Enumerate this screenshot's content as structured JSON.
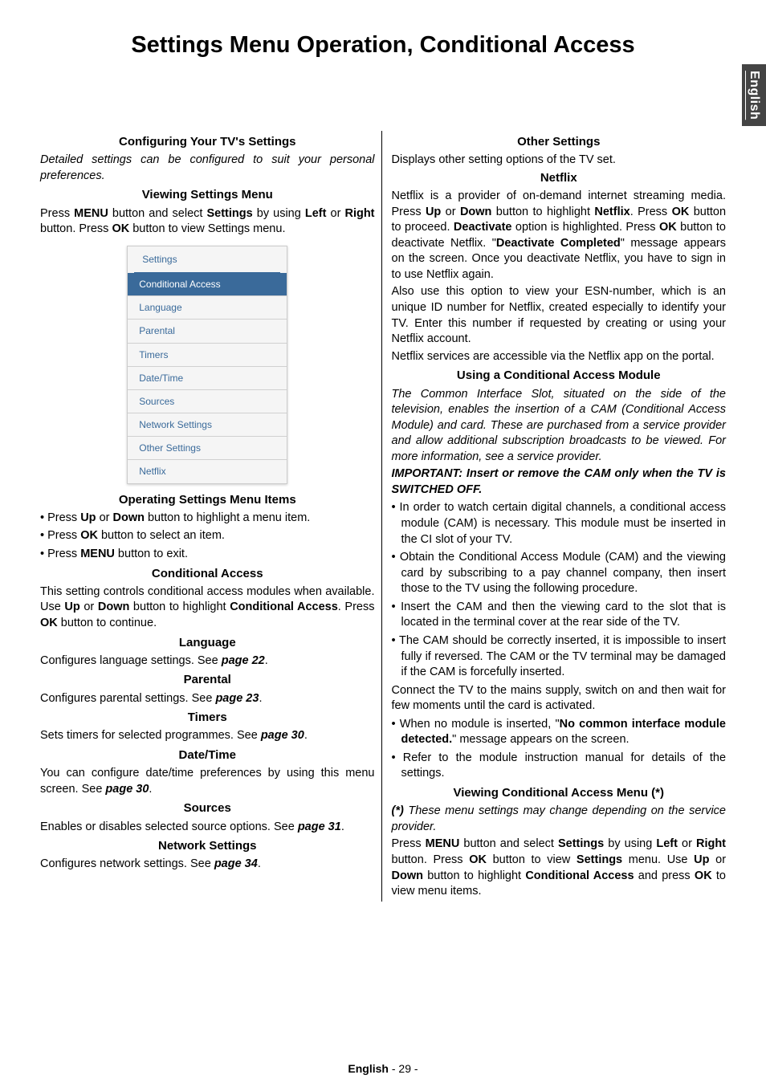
{
  "main_title": "Settings Menu Operation, Conditional Access",
  "language_tab": "English",
  "footer_lang": "English",
  "footer_page": "  - 29 -",
  "left": {
    "h_configuring": "Configuring Your TV's Settings",
    "p_configuring": "Detailed settings can be configured to suit your personal preferences.",
    "h_viewing": "Viewing Settings Menu",
    "p_viewing_1": "Press ",
    "p_viewing_b1": "MENU",
    "p_viewing_2": " button and select ",
    "p_viewing_b2": "Settings",
    "p_viewing_3": " by using ",
    "p_viewing_b3": "Left",
    "p_viewing_4": " or ",
    "p_viewing_b4": "Right",
    "p_viewing_5": " button. Press ",
    "p_viewing_b5": "OK",
    "p_viewing_6": " button to view Settings menu.",
    "settings_box": {
      "title": "Settings",
      "items": [
        "Conditional Access",
        "Language",
        "Parental",
        "Timers",
        "Date/Time",
        "Sources",
        "Network Settings",
        "Other Settings",
        "Netflix"
      ]
    },
    "h_operating": "Operating Settings Menu Items",
    "li_op_1a": "Press ",
    "li_op_1b": "Up",
    "li_op_1c": " or ",
    "li_op_1d": "Down",
    "li_op_1e": " button to highlight a menu item.",
    "li_op_2a": "Press ",
    "li_op_2b": "OK",
    "li_op_2c": " button to select an item.",
    "li_op_3a": "Press ",
    "li_op_3b": "MENU",
    "li_op_3c": " button to exit.",
    "h_conditional": "Conditional Access",
    "p_cond_1": "This setting controls conditional access modules when available. Use ",
    "p_cond_b1": "Up",
    "p_cond_2": " or ",
    "p_cond_b2": "Down",
    "p_cond_3": " button to highlight ",
    "p_cond_b3": "Conditional Access",
    "p_cond_4": ". Press ",
    "p_cond_b4": "OK",
    "p_cond_5": " button to continue.",
    "h_language": "Language",
    "p_lang_1": "Configures language settings. See ",
    "p_lang_b": "page 22",
    "p_lang_2": ".",
    "h_parental": "Parental",
    "p_par_1": "Configures parental settings. See ",
    "p_par_b": "page 23",
    "p_par_2": ".",
    "h_timers": "Timers",
    "p_tim_1": "Sets timers for selected programmes. See ",
    "p_tim_b": "page 30",
    "p_tim_2": ".",
    "h_datetime": "Date/Time",
    "p_dt_1": "You can configure date/time preferences by using this menu screen. See ",
    "p_dt_b": "page 30",
    "p_dt_2": ".",
    "h_sources": "Sources",
    "p_src_1": "Enables or disables selected source options. See ",
    "p_src_b": "page 31",
    "p_src_2": ".",
    "h_network": "Network Settings",
    "p_net_1": "Configures network settings. See ",
    "p_net_b": "page 34",
    "p_net_2": "."
  },
  "right": {
    "h_other": "Other Settings",
    "p_other": "Displays other setting options of the TV set.",
    "h_netflix": "Netflix",
    "p_nf_1": "Netflix is a provider of on-demand internet streaming media. Press ",
    "p_nf_b1": "Up",
    "p_nf_2": " or ",
    "p_nf_b2": "Down",
    "p_nf_3": " button to highlight ",
    "p_nf_b3": "Netflix",
    "p_nf_4": ". Press ",
    "p_nf_b4": "OK",
    "p_nf_5": " button to proceed. ",
    "p_nf_b5": "Deactivate",
    "p_nf_6": " option is highlighted. Press ",
    "p_nf_b6": "OK",
    "p_nf_7": " button to deactivate Netflix. \"",
    "p_nf_b7": "Deactivate Completed",
    "p_nf_8": "\" message appears on the screen. Once you deactivate Netflix, you have to sign in to use Netflix again.",
    "p_nf_esn": "Also use this option to view your ESN-number, which is an unique ID number for Netflix, created especially to identify your TV. Enter this number if requested by creating or using your Netflix account.",
    "p_nf_portal": "Netflix services are accessible via the Netflix app on the portal.",
    "h_cam": "Using a Conditional Access Module",
    "p_cam_intro": "The Common Interface Slot, situated on the side of the television, enables the insertion of a CAM (Conditional Access Module) and card. These are purchased from a service provider and allow additional subscription broadcasts to be viewed. For more information, see a service provider.",
    "p_cam_important": "IMPORTANT: Insert or remove the CAM only when the TV is SWITCHED OFF.",
    "li_cam_1": "In order to watch certain digital channels, a conditional access module (CAM) is necessary. This module must be inserted in the CI slot of your TV.",
    "li_cam_2": "Obtain the Conditional Access Module (CAM) and the viewing card by subscribing to a pay channel company, then insert those to the TV using the following procedure.",
    "li_cam_3": "Insert the CAM and then the viewing card to the slot that is located in the terminal cover at the rear side of the TV.",
    "li_cam_4": "The CAM should be correctly inserted, it is impossible to insert fully if reversed. The CAM or the TV terminal may be damaged if the CAM is forcefully inserted.",
    "p_cam_connect": "Connect the TV to the mains supply, switch on and then wait for few moments until the card is activated.",
    "li_cam_5a": "When no module is inserted, \"",
    "li_cam_5b": "No common interface module detected.",
    "li_cam_5c": "\" message appears on the screen.",
    "li_cam_6": "Refer to the module instruction manual for details of the settings.",
    "h_view_cam": "Viewing Conditional Access Menu (*)",
    "p_view_asterisk": "(*) These menu settings may change depending on the service provider.",
    "p_vc_1": "Press ",
    "p_vc_b1": "MENU",
    "p_vc_2": " button and select ",
    "p_vc_b2": "Settings",
    "p_vc_3": " by using ",
    "p_vc_b3": "Left",
    "p_vc_4": " or ",
    "p_vc_b4": "Right",
    "p_vc_5": " button. Press ",
    "p_vc_b5": "OK",
    "p_vc_6": " button to view ",
    "p_vc_b6": "Settings",
    "p_vc_7": " menu. Use ",
    "p_vc_b7": "Up",
    "p_vc_8": " or ",
    "p_vc_b8": "Down",
    "p_vc_9": " button to highlight ",
    "p_vc_b9": "Conditional Access",
    "p_vc_10": " and press ",
    "p_vc_b10": "OK",
    "p_vc_11": " to view menu items."
  }
}
